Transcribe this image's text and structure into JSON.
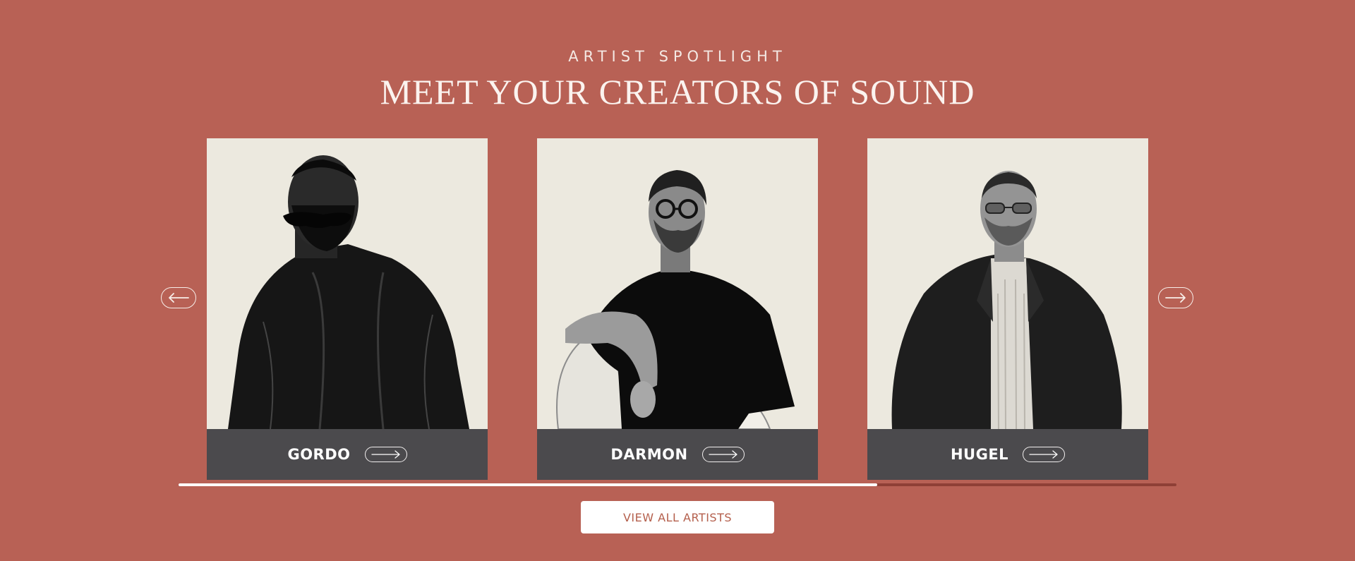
{
  "section": {
    "eyebrow": "ARTIST SPOTLIGHT",
    "title": "MEET YOUR CREATORS OF SOUND"
  },
  "artists": [
    {
      "name": "GORDO"
    },
    {
      "name": "DARMON"
    },
    {
      "name": "HUGEL"
    }
  ],
  "carousel": {
    "prev_icon": "arrow-left-icon",
    "next_icon": "arrow-right-icon",
    "progress_fraction": 0.7
  },
  "cta": {
    "label": "VIEW ALL ARTISTS"
  },
  "colors": {
    "background": "#b86155",
    "card_background": "#ece9df",
    "card_footer": "#4b4a4d",
    "progress_fill": "#ffffff",
    "progress_track": "#8e4036",
    "cta_text": "#b45f4c"
  }
}
